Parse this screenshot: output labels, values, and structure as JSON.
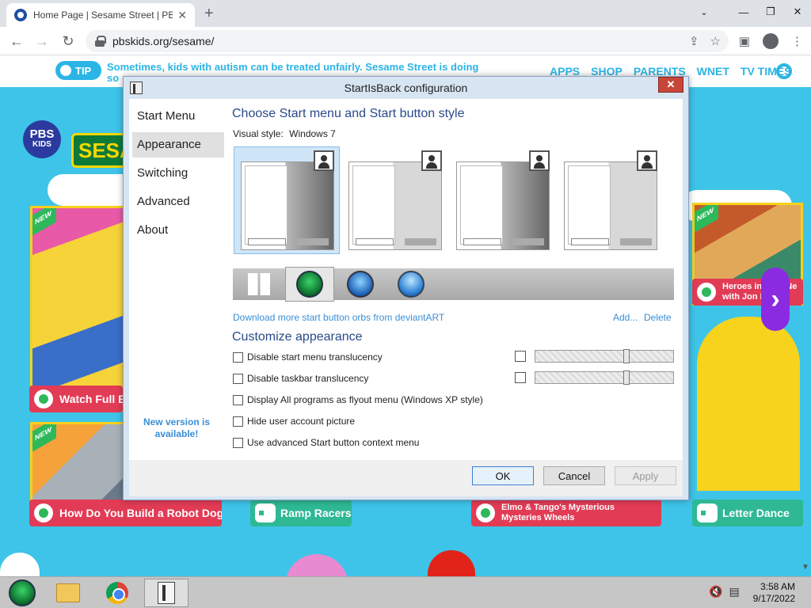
{
  "browser": {
    "tab_title": "Home Page | Sesame Street | PBS",
    "url": "pbskids.org/sesame/",
    "new_tab_label": "+"
  },
  "site": {
    "tip_label": "TIP",
    "tip_text": "Sometimes, kids with autism can be treated unfairly. Sesame Street is doing so",
    "nav": [
      "APPS",
      "SHOP",
      "PARENTS",
      "WNET",
      "TV TIMES"
    ],
    "pbs_logo_line1": "PBS",
    "pbs_logo_line2": "KIDS",
    "sesame_logo": "SESAM",
    "new_flag": "NEW",
    "cards": {
      "watch_full": "Watch Full E",
      "robot_dog": "How Do You Build a Robot Dog",
      "ramp_racers": "Ramp Racers",
      "elmo_tango": "Elmo & Tango's Mysterious Mysteries Wheels",
      "letter_dance": "Letter Dance",
      "heroes": "Heroes in Your Ne with Jon Batiste"
    }
  },
  "dialog": {
    "title": "StartIsBack configuration",
    "close_label": "✕",
    "sidebar": [
      "Start Menu",
      "Appearance",
      "Switching",
      "Advanced",
      "About"
    ],
    "active_sidebar_index": 1,
    "new_version": "New version is available!",
    "section1_title": "Choose Start menu and Start button style",
    "visual_style_label": "Visual style:",
    "visual_style_value": "Windows 7",
    "download_link": "Download more start button orbs from deviantART",
    "add_link": "Add...",
    "delete_link": "Delete",
    "section2_title": "Customize appearance",
    "options": [
      "Disable start menu translucency",
      "Disable taskbar translucency",
      "Display All programs as flyout menu (Windows XP style)",
      "Hide user account picture",
      "Use advanced Start button context menu"
    ],
    "sliders": [
      0.67,
      0.67
    ],
    "buttons": {
      "ok": "OK",
      "cancel": "Cancel",
      "apply": "Apply"
    }
  },
  "taskbar": {
    "time": "3:58 AM",
    "date": "9/17/2022"
  }
}
